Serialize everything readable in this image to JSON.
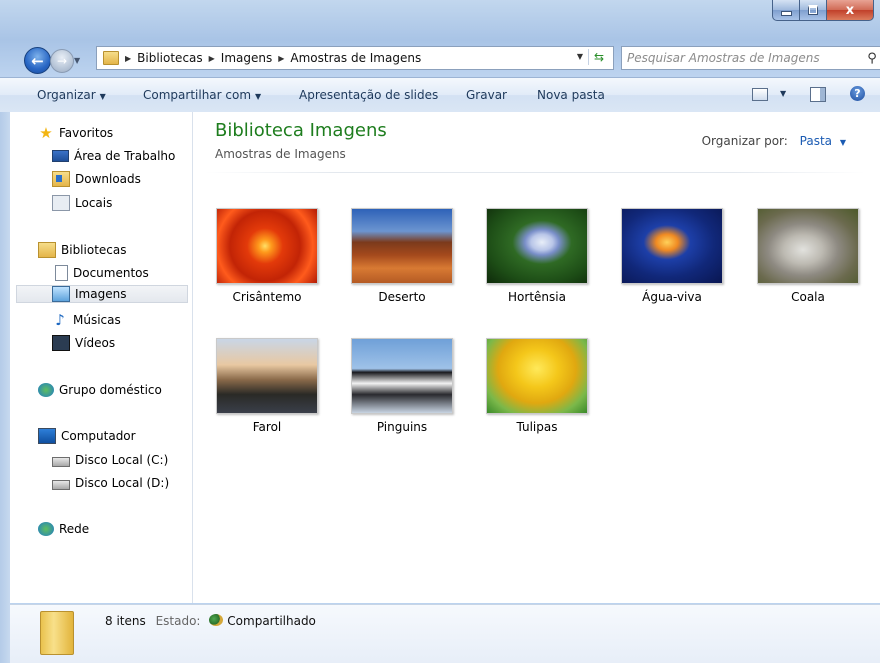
{
  "window": {
    "close_glyph": "x"
  },
  "nav": {
    "breadcrumbs": [
      "Bibliotecas",
      "Imagens",
      "Amostras de Imagens"
    ],
    "search_placeholder": "Pesquisar Amostras de Imagens"
  },
  "toolbar": {
    "organize": "Organizar",
    "share": "Compartilhar com",
    "slideshow": "Apresentação de slides",
    "burn": "Gravar",
    "new_folder": "Nova pasta",
    "help": "?"
  },
  "sidebar": {
    "favorites": "Favoritos",
    "desktop": "Área de Trabalho",
    "downloads": "Downloads",
    "recent": "Locais",
    "libraries": "Bibliotecas",
    "documents": "Documentos",
    "pictures": "Imagens",
    "music": "Músicas",
    "videos": "Vídeos",
    "homegroup": "Grupo doméstico",
    "computer": "Computador",
    "disk_c": "Disco Local (C:)",
    "disk_d": "Disco Local (D:)",
    "network": "Rede"
  },
  "content": {
    "title": "Biblioteca Imagens",
    "subtitle": "Amostras de Imagens",
    "arrange_label": "Organizar por:",
    "arrange_value": "Pasta",
    "items": [
      {
        "name": "Crisântemo"
      },
      {
        "name": "Deserto"
      },
      {
        "name": "Hortênsia"
      },
      {
        "name": "Água-viva"
      },
      {
        "name": "Coala"
      },
      {
        "name": "Farol"
      },
      {
        "name": "Pinguins"
      },
      {
        "name": "Tulipas"
      }
    ]
  },
  "details": {
    "count": "8 itens",
    "state_label": "Estado:",
    "state_value": "Compartilhado"
  },
  "colors": {
    "library_title": "#1e7d1e",
    "link_blue": "#1b5bb3"
  }
}
